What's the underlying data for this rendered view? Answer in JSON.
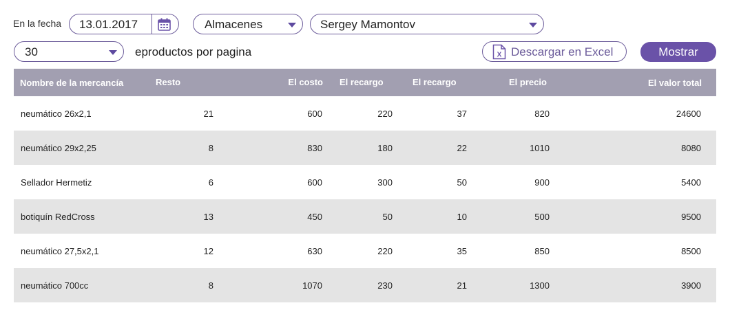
{
  "filters": {
    "date_label": "En la fecha",
    "date_value": "13.01.2017",
    "warehouse": "Almacenes",
    "user": "Sergey Mamontov",
    "per_page_value": "30",
    "per_page_label": "eproductos por pagina",
    "excel_label": "Descargar en Excel",
    "show_label": "Mostrar"
  },
  "table": {
    "headers": [
      "Nombre de la mercancía",
      "Resto",
      "El costo",
      "El recargo",
      "El recargo",
      "El precio",
      "El valor total"
    ],
    "rows": [
      [
        "neumático 26x2,1",
        "21",
        "600",
        "220",
        "37",
        "820",
        "24600"
      ],
      [
        "neumático 29x2,25",
        "8",
        "830",
        "180",
        "22",
        "1010",
        "8080"
      ],
      [
        "Sellador Hermetiz",
        "6",
        "600",
        "300",
        "50",
        "900",
        "5400"
      ],
      [
        "botiquín RedCross",
        "13",
        "450",
        "50",
        "10",
        "500",
        "9500"
      ],
      [
        "neumático 27,5x2,1",
        "12",
        "630",
        "220",
        "35",
        "850",
        "8500"
      ],
      [
        "neumático 700cc",
        "8",
        "1070",
        "230",
        "21",
        "1300",
        "3900"
      ]
    ]
  },
  "colors": {
    "accent": "#6a52a8",
    "header_bg": "#a29fb1",
    "alt_row": "#e4e4e4"
  },
  "icons": {
    "calendar": "calendar-icon",
    "excel": "excel-file-icon",
    "dropdown": "chevron-down-icon"
  }
}
